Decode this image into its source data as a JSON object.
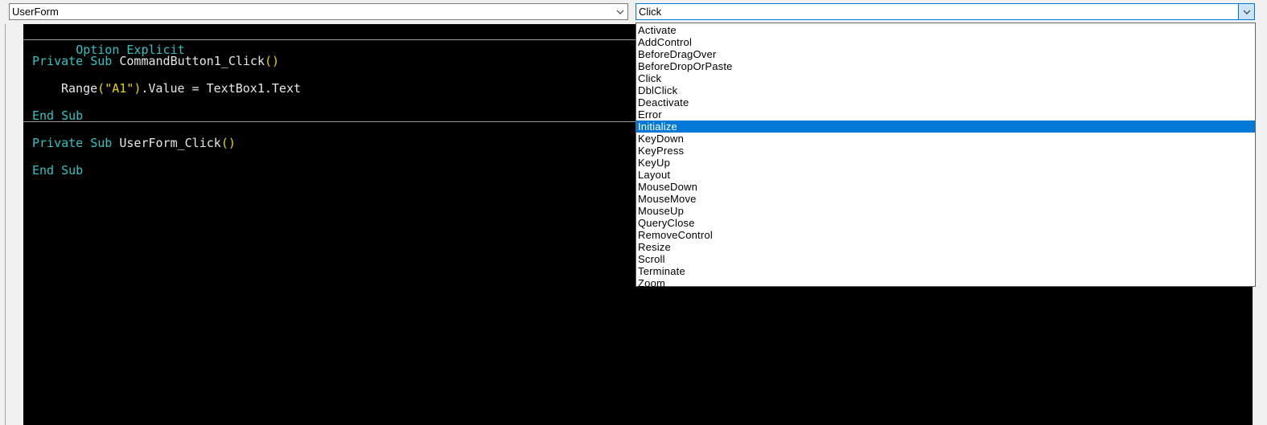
{
  "object_combo": {
    "value": "UserForm"
  },
  "procedure_combo": {
    "value": "Click"
  },
  "code": {
    "option_keyword": "Option Explicit",
    "proc1": {
      "private": "Private",
      "sub": "Sub",
      "name": "CommandButton1_Click",
      "parens": "()"
    },
    "body1": {
      "range": "Range",
      "open": "(",
      "arg": "\"A1\"",
      "close": ")",
      "rest": ".Value = TextBox1.Text"
    },
    "end1": "End Sub",
    "proc2": {
      "private": "Private",
      "sub": "Sub",
      "name": "UserForm_Click",
      "parens": "()"
    },
    "end2": "End Sub"
  },
  "dropdown": {
    "selected_index": 8,
    "items": [
      "Activate",
      "AddControl",
      "BeforeDragOver",
      "BeforeDropOrPaste",
      "Click",
      "DblClick",
      "Deactivate",
      "Error",
      "Initialize",
      "KeyDown",
      "KeyPress",
      "KeyUp",
      "Layout",
      "MouseDown",
      "MouseMove",
      "MouseUp",
      "QueryClose",
      "RemoveControl",
      "Resize",
      "Scroll",
      "Terminate",
      "Zoom"
    ]
  },
  "colors": {
    "keyword": "#2ec4c4",
    "paren_string": "#e6d400",
    "selection": "#0078d7",
    "editor_bg": "#000000"
  },
  "icons": {
    "combo_arrow": "chevron-down-icon"
  }
}
